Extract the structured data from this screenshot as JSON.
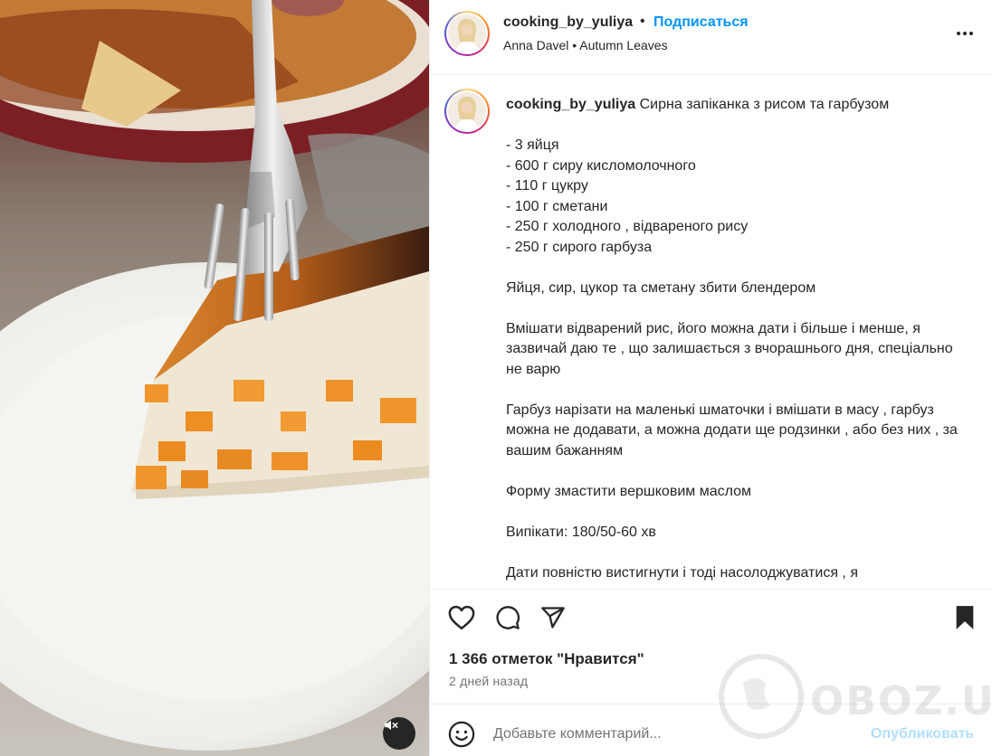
{
  "post": {
    "username": "cooking_by_yuliya",
    "separator": "•",
    "follow_label": "Подписаться",
    "audio": "Anna Davel • Autumn Leaves",
    "more_icon": "more-horizontal-icon"
  },
  "caption": {
    "username": "cooking_by_yuliya",
    "text": " Сирна запіканка з рисом та гарбузом\n\n- 3 яйця\n- 600 г сиру кисломолочного\n- 110 г цукру\n- 100 г сметани\n- 250 г холодного , відвареного рису\n- 250 г сирого гарбуза\n\nЯйця, сир, цукор та сметану збити блендером\n\nВмішати відварений рис, його можна дати і більше і менше, я зазвичай даю те , що залишається з вчорашнього дня, спеціально не варю\n\nГарбуз нарізати на маленькі шматочки і вмішати в масу , гарбуз можна не додавати, а можна додати ще родзинки , або без них , за вашим бажанням\n\nФорму змастити вершковим маслом\n\nВипікати: 180/50-60 хв\n\nДати повністю вистигнути і тоді насолоджуватися , я"
  },
  "actions": {
    "icons": [
      "heart-icon",
      "comment-icon",
      "share-icon",
      "bookmark-icon"
    ],
    "likes": "1 366 отметок \"Нравится\"",
    "time": "2 дней назад"
  },
  "comment": {
    "placeholder": "Добавьте комментарий...",
    "post_label": "Опубликовать"
  },
  "watermark": {
    "text": "OBOZ.UA"
  },
  "colors": {
    "accent": "#0095f6",
    "post_disabled": "#b2dffc",
    "text": "#262626",
    "muted": "#737373",
    "divider": "#efefef"
  }
}
